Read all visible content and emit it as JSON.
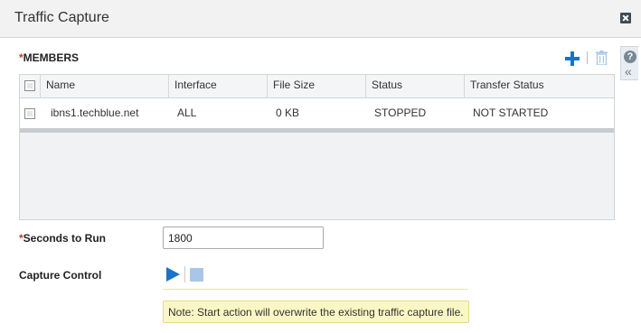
{
  "dialog": {
    "title": "Traffic Capture"
  },
  "members": {
    "required_mark": "*",
    "label": "MEMBERS",
    "columns": [
      "Name",
      "Interface",
      "File Size",
      "Status",
      "Transfer Status"
    ],
    "rows": [
      {
        "name": "ibns1.techblue.net",
        "interface": "ALL",
        "file_size": "0 KB",
        "status": "STOPPED",
        "transfer_status": "NOT STARTED"
      }
    ]
  },
  "seconds_to_run": {
    "required_mark": "*",
    "label": "Seconds to Run",
    "value": "1800"
  },
  "capture_control": {
    "label": "Capture Control",
    "note": "Note: Start action will overwrite the existing traffic capture file."
  },
  "icons": {
    "close": "close-icon",
    "help": "help-icon",
    "collapse": "double-chevron-left-icon",
    "add": "plus-icon",
    "delete": "trash-icon",
    "play": "play-icon",
    "stop": "stop-icon"
  },
  "colors": {
    "accent": "#1a73c9",
    "note_bg": "#fbf7c5",
    "required": "#c0392b"
  }
}
